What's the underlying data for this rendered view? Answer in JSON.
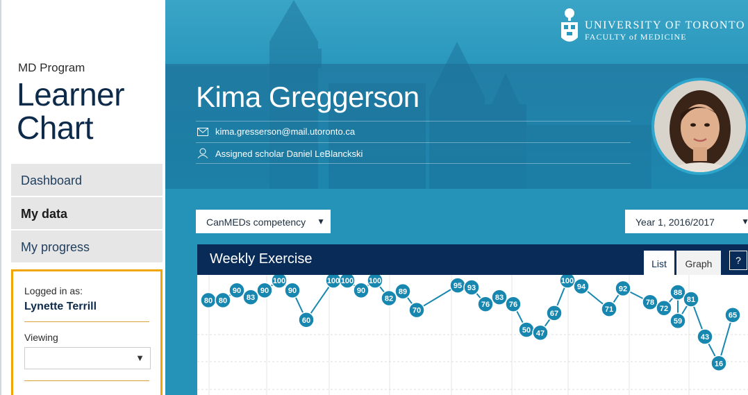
{
  "sidebar": {
    "program": "MD Program",
    "title_line1": "Learner",
    "title_line2": "Chart",
    "nav": [
      {
        "label": "Dashboard"
      },
      {
        "label": "My data"
      },
      {
        "label": "My progress"
      }
    ],
    "login": {
      "label": "Logged in as:",
      "name": "Lynette Terrill",
      "viewing_label": "Viewing",
      "viewing_value": ""
    }
  },
  "header": {
    "university": "UNIVERSITY OF TORONTO",
    "faculty": "FACULTY of MEDICINE",
    "student_name": "Kima Greggerson",
    "email": "kima.gresserson@mail.utoronto.ca",
    "scholar": "Assigned scholar Daniel LeBlanckski"
  },
  "filters": {
    "competency": "CanMEDs competency",
    "year": "Year 1, 2016/2017"
  },
  "panel": {
    "title": "Weekly Exercise",
    "list_label": "List",
    "graph_label": "Graph",
    "help_label": "?"
  },
  "colors": {
    "accent": "#f0a500",
    "navy": "#082c57",
    "teal": "#1a8ab0",
    "point": "#1887b0"
  },
  "chart_data": {
    "type": "line",
    "x": [
      1,
      2,
      3,
      4,
      5,
      6,
      7,
      8,
      9,
      10,
      11,
      12,
      13,
      14,
      15,
      16,
      17,
      18,
      19,
      20,
      21,
      22,
      23,
      24,
      25,
      26,
      27,
      28,
      29,
      30,
      31,
      32,
      33,
      34,
      35,
      36,
      37,
      38
    ],
    "series": [
      {
        "values": [
          80,
          80,
          90,
          83,
          90,
          100,
          90,
          60,
          100,
          100,
          90,
          100,
          82,
          89,
          70,
          95,
          93,
          76,
          83,
          76,
          50,
          47,
          67,
          100,
          94,
          71,
          92,
          78,
          72,
          88,
          59,
          81,
          43,
          16,
          65
        ]
      }
    ],
    "ylim": [
      0,
      110
    ],
    "grid": true
  }
}
